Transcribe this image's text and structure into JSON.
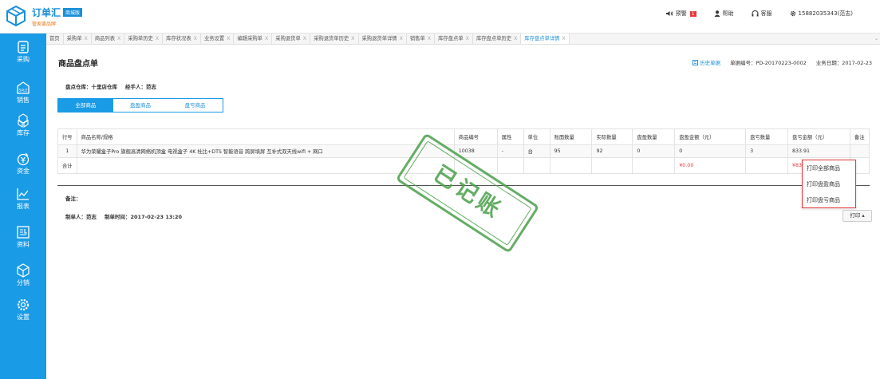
{
  "brand": {
    "name": "订单汇",
    "badge": "商城版",
    "sub": "管家婆品牌"
  },
  "topbar": {
    "alert_label": "预警",
    "alert_count": "1",
    "help_label": "帮助",
    "service_label": "客服",
    "user_label": "15882035343(范志)"
  },
  "tabs": [
    {
      "label": "首页",
      "closable": false
    },
    {
      "label": "采购单",
      "closable": true
    },
    {
      "label": "商品列表",
      "closable": true
    },
    {
      "label": "采购单历史",
      "closable": true
    },
    {
      "label": "库存状况表",
      "closable": true
    },
    {
      "label": "业务设置",
      "closable": true
    },
    {
      "label": "编辑采购单",
      "closable": true
    },
    {
      "label": "采购退货单",
      "closable": true
    },
    {
      "label": "采购退货单历史",
      "closable": true
    },
    {
      "label": "采购退货单详情",
      "closable": true
    },
    {
      "label": "销售单",
      "closable": true
    },
    {
      "label": "库存盘点单",
      "closable": true
    },
    {
      "label": "库存盘点单历史",
      "closable": true
    },
    {
      "label": "库存盘点单详情",
      "closable": true,
      "active": true
    }
  ],
  "tab_close": "X",
  "sidebar": [
    {
      "label": "采购",
      "icon": "purchase-icon"
    },
    {
      "label": "销售",
      "icon": "sale-icon",
      "icon_text": "SALE"
    },
    {
      "label": "库存",
      "icon": "inventory-icon"
    },
    {
      "label": "资金",
      "icon": "finance-icon"
    },
    {
      "label": "报表",
      "icon": "report-icon"
    },
    {
      "label": "资料",
      "icon": "data-icon"
    },
    {
      "label": "分销",
      "icon": "distribution-icon"
    },
    {
      "label": "设置",
      "icon": "settings-icon"
    }
  ],
  "page": {
    "title": "商品盘点单",
    "history_link": "历史单据",
    "doc_no": "单据编号：PD-20170223-0002",
    "biz_date": "业务日期：2017-02-23",
    "warehouse": "盘点仓库：十里店仓库",
    "handler": "经手人：范志"
  },
  "filter_tabs": [
    "全部商品",
    "盘盈商品",
    "盘亏商品"
  ],
  "table": {
    "headers": [
      "行号",
      "商品名称/规格",
      "商品编号",
      "属性",
      "单位",
      "账面数量",
      "实际数量",
      "盘盈数量",
      "盘盈金额（元）",
      "盘亏数量",
      "盘亏金额（元）",
      "备注"
    ],
    "rows": [
      [
        "1",
        "华为荣耀盒子Pro 旗舰高清网络机顶盒 电视盒子 4K 杜比+DTS 智能语音 跨屏填屏 互补式双天线wifi + 网口",
        "10038",
        "-",
        "台",
        "95",
        "92",
        "0",
        "0",
        "3",
        "833.91",
        ""
      ]
    ],
    "sum_label": "合计",
    "sum_gain_amount": "¥0.00",
    "sum_loss_amount": "¥833.91"
  },
  "remark_label": "备注：",
  "maker": "制单人：范志",
  "make_time": "制单时间：2017-02-23 13:20",
  "print_menu": [
    "打印全部商品",
    "打印盘盈商品",
    "打印盘亏商品"
  ],
  "print_button": "打印 ▴",
  "stamp_text": "已记账"
}
